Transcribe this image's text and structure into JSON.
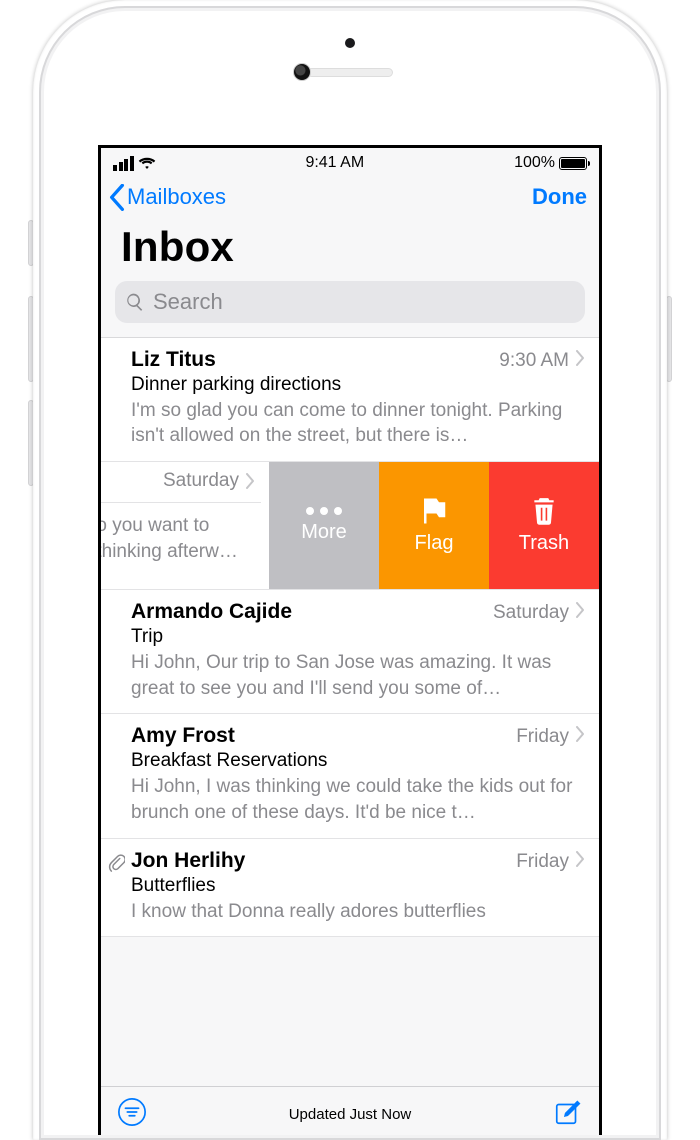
{
  "status_bar": {
    "time": "9:41 AM",
    "battery_pct": "100%"
  },
  "nav": {
    "back_label": "Mailboxes",
    "done_label": "Done"
  },
  "title": "Inbox",
  "search": {
    "placeholder": "Search"
  },
  "swipe_actions": {
    "more": "More",
    "flag": "Flag",
    "trash": "Trash"
  },
  "swiped_row": {
    "time": "Saturday",
    "partial_line1": "s do you want to",
    "partial_line2": "as thinking afterw…"
  },
  "messages": [
    {
      "sender": "Liz Titus",
      "time": "9:30 AM",
      "subject": "Dinner parking directions",
      "preview": "I'm so glad you can come to dinner tonight. Parking isn't allowed on the street, but there is…",
      "attachment": false
    },
    {
      "sender": "Armando Cajide",
      "time": "Saturday",
      "subject": "Trip",
      "preview": "Hi John, Our trip to San Jose was amazing. It was great to see you and I'll send you some of…",
      "attachment": false
    },
    {
      "sender": "Amy Frost",
      "time": "Friday",
      "subject": "Breakfast Reservations",
      "preview": "Hi John, I was thinking we could take the kids out for brunch one of these days. It'd be nice t…",
      "attachment": false
    },
    {
      "sender": "Jon Herlihy",
      "time": "Friday",
      "subject": "Butterflies",
      "preview": "I know that Donna really adores butterflies",
      "attachment": true
    }
  ],
  "toolbar": {
    "status": "Updated Just Now"
  }
}
